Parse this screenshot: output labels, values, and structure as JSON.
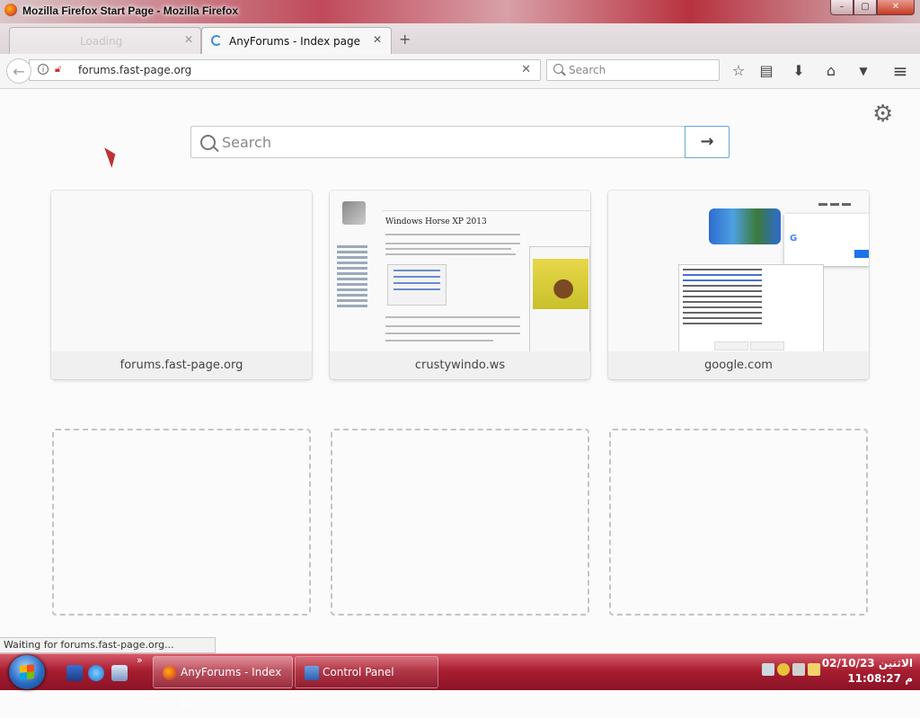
{
  "window": {
    "title": "Mozilla Firefox Start Page - Mozilla Firefox",
    "controls": {
      "minimize": "–",
      "maximize": "▢",
      "close": "✕"
    }
  },
  "tabs": [
    {
      "label": "Loading",
      "close": "✕"
    },
    {
      "label": "AnyForums - Index page",
      "close": "✕"
    }
  ],
  "new_tab": "+",
  "nav": {
    "back": "←",
    "url": "forums.fast-page.org",
    "clear": "✕",
    "search_placeholder": "Search"
  },
  "toolbar": {
    "bookmark": "☆",
    "library": "▤",
    "downloads": "⬇",
    "home": "⌂",
    "pocket": "▼",
    "menu": "≡"
  },
  "newtab": {
    "settings": "⚙",
    "search_placeholder": "Search",
    "go": "→",
    "tiles": [
      {
        "caption": "forums.fast-page.org"
      },
      {
        "caption": "crustywindo.ws"
      },
      {
        "caption": "google.com"
      }
    ]
  },
  "wiki_thumb": {
    "title": "Windows Horse XP 2013"
  },
  "status": "Waiting for forums.fast-page.org...",
  "taskbar": {
    "chevron": "»",
    "buttons": [
      {
        "label": "AnyForums - Index p..."
      },
      {
        "label": "Control Panel"
      }
    ],
    "clock": {
      "date": "الاثنين 02/10/23",
      "time": "م 11:08:27"
    }
  },
  "colors": {
    "taskbar": "#a81e30",
    "accent": "#6aa7d8"
  }
}
